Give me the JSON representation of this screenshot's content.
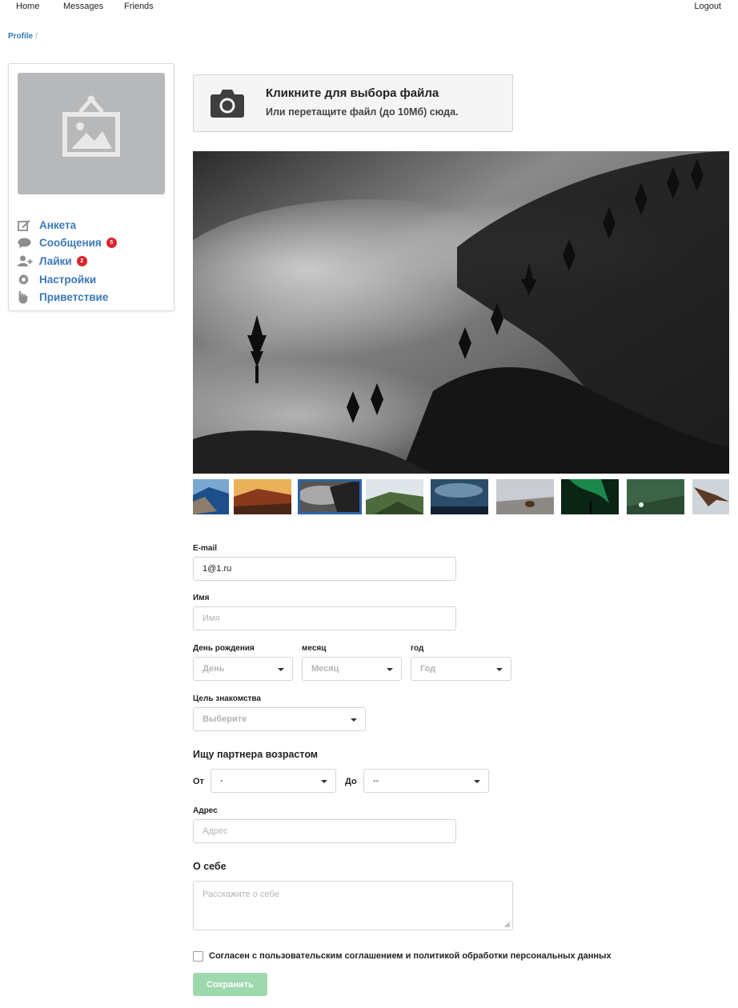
{
  "nav": {
    "home": "Home",
    "messages": "Messages",
    "friends": "Friends",
    "logout": "Logout"
  },
  "breadcrumb": {
    "current": "Profile",
    "separator": "/"
  },
  "sidebar": {
    "avatar_icon": "image-placeholder-icon",
    "items": [
      {
        "label": "Анкета",
        "icon": "edit-icon",
        "badge": null
      },
      {
        "label": "Сообщения",
        "icon": "comment-icon",
        "badge": "5"
      },
      {
        "label": "Лайки",
        "icon": "user-plus-icon",
        "badge": "2"
      },
      {
        "label": "Настройки",
        "icon": "gear-icon",
        "badge": null
      },
      {
        "label": "Приветствие",
        "icon": "hand-icon",
        "badge": null
      }
    ]
  },
  "upload": {
    "title": "Кликните для выбора файла",
    "subtitle": "Или перетащите файл (до 10Мб) сюда.",
    "icon": "camera-icon"
  },
  "gallery": {
    "active_index": 2,
    "thumb_count": 9
  },
  "form": {
    "email": {
      "label": "E-mail",
      "value": "1@1.ru"
    },
    "name": {
      "label": "Имя",
      "placeholder": "Имя"
    },
    "birthday": {
      "label_day": "День рождения",
      "label_month": "месяц",
      "label_year": "год",
      "day": "День",
      "month": "Месяц",
      "year": "Год"
    },
    "goal": {
      "label": "Цель знакомства",
      "value": "Выберите"
    },
    "partner_age": {
      "heading": "Ищу партнера возрастом",
      "from_label": "От",
      "from_value": "-",
      "to_label": "До",
      "to_value": "--"
    },
    "address": {
      "label": "Адрес",
      "placeholder": "Адрес"
    },
    "about": {
      "heading": "О себе",
      "placeholder": "Расскажите о себе"
    },
    "agreement": "Согласен с пользовательским соглашением и политикой обработки персональных данных",
    "save": "Сохранить"
  },
  "colors": {
    "link": "#3a78b8",
    "badge": "#d9252c",
    "save_disabled": "#9ed8ad",
    "active_thumb": "#2d64a8"
  }
}
